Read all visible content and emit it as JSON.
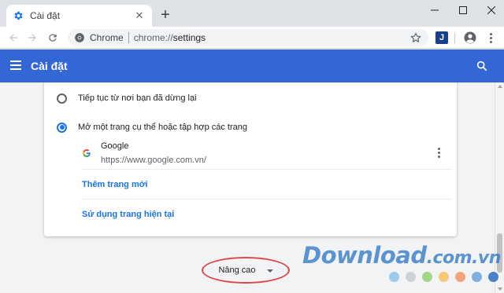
{
  "browser": {
    "tab": {
      "title": "Cài đặt",
      "favicon": "gear-icon",
      "favicon_color": "#1a73e8"
    },
    "omnibox": {
      "site_chip": "Chrome",
      "url_host": "chrome://",
      "url_path": "settings"
    },
    "extension_label": "J"
  },
  "header": {
    "title": "Cài đặt",
    "background": "#3367d6"
  },
  "startup": {
    "options": [
      {
        "label": "Tiếp tục từ nơi bạn đã dừng lại",
        "checked": false
      },
      {
        "label": "Mở một trang cụ thể hoặc tập hợp các trang",
        "checked": true
      }
    ],
    "pages": [
      {
        "name": "Google",
        "url": "https://www.google.com.vn/"
      }
    ],
    "add_page_label": "Thêm trang mới",
    "use_current_label": "Sử dụng trang hiện tại"
  },
  "advanced": {
    "label": "Nâng cao",
    "highlight_color": "#e0474c"
  },
  "watermark": {
    "brand": "Download",
    "tld": ".com.vn",
    "dot_colors": [
      "#9ecbe8",
      "#cfd2d4",
      "#a6d48a",
      "#f6c87a",
      "#f3a27a",
      "#7fb0e0",
      "#4a82c8"
    ]
  }
}
